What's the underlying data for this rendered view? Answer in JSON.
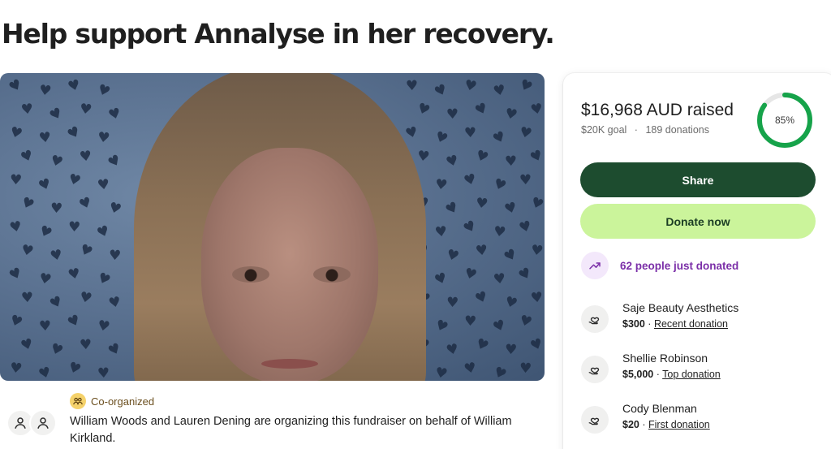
{
  "page": {
    "title": "Help support Annalyse in her recovery."
  },
  "organizers": {
    "badge_label": "Co-organized",
    "description": "William Woods and Lauren Dening are organizing this fundraiser on behalf of William Kirkland."
  },
  "donation_card": {
    "raised_text": "$16,968 AUD raised",
    "goal_text": "$20K goal",
    "separator": "·",
    "donations_text": "189 donations",
    "progress_percent": 85,
    "progress_label": "85%",
    "share_label": "Share",
    "donate_label": "Donate now",
    "momentum_text": "62 people just donated",
    "recent_donations": [
      {
        "name": "Saje Beauty Aesthetics",
        "amount": "$300",
        "tag": "Recent donation"
      },
      {
        "name": "Shellie Robinson",
        "amount": "$5,000",
        "tag": "Top donation"
      },
      {
        "name": "Cody Blenman",
        "amount": "$20",
        "tag": "First donation"
      }
    ]
  },
  "colors": {
    "share_button": "#1d4c2f",
    "donate_button": "#cbf49b",
    "progress_ring": "#16a34a",
    "momentum_text": "#7b2fa8"
  },
  "icons": {
    "co_organized": "people-icon",
    "avatar": "user-icon",
    "momentum": "trending-up-icon",
    "donation": "heart-hand-icon"
  }
}
